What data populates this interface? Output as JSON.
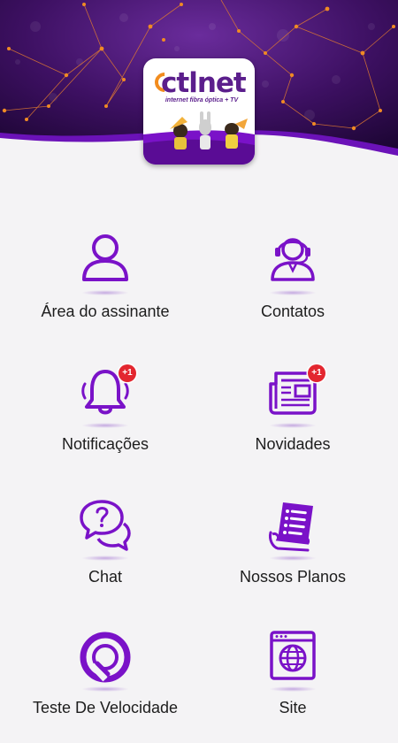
{
  "brand": {
    "name": "ctlnet",
    "tagline": "internet fibra óptica + TV"
  },
  "colors": {
    "primary": "#7a12c8",
    "header_dark": "#2a0844",
    "node_accent": "#f08a24",
    "badge": "#e3262f",
    "background": "#f4f3f5"
  },
  "menu": [
    {
      "id": "area-do-assinante",
      "label": "Área do assinante",
      "icon": "user-icon"
    },
    {
      "id": "contatos",
      "label": "Contatos",
      "icon": "support-agent-icon"
    },
    {
      "id": "notificacoes",
      "label": "Notificações",
      "icon": "bell-icon",
      "badge": "+1"
    },
    {
      "id": "novidades",
      "label": "Novidades",
      "icon": "newspaper-icon",
      "badge": "+1"
    },
    {
      "id": "chat",
      "label": "Chat",
      "icon": "chat-bubbles-icon"
    },
    {
      "id": "nossos-planos",
      "label": "Nossos Planos",
      "icon": "document-list-icon"
    },
    {
      "id": "teste-de-velocidade",
      "label": "Teste De Velocidade",
      "icon": "speedometer-icon"
    },
    {
      "id": "site",
      "label": "Site",
      "icon": "website-globe-icon"
    }
  ]
}
